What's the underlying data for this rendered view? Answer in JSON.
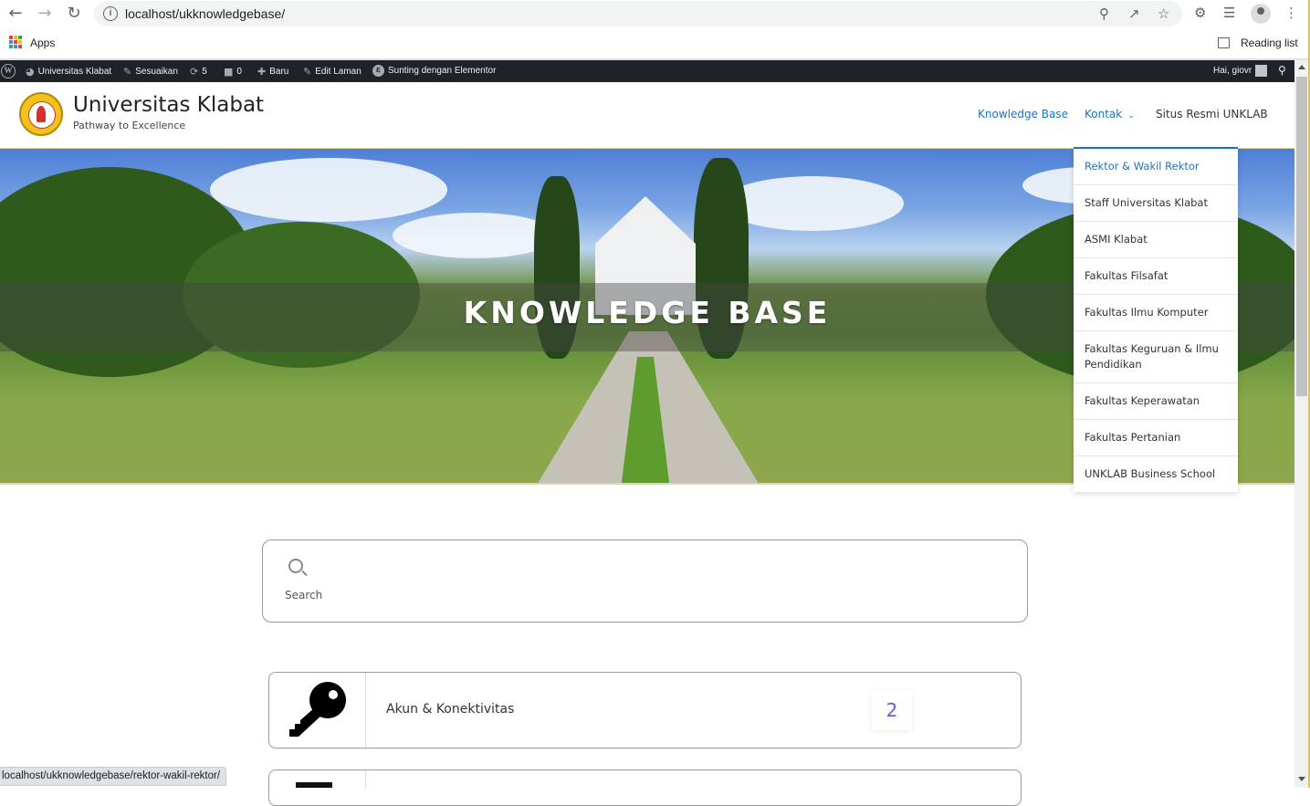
{
  "browser": {
    "url": "localhost/ukknowledgebase/",
    "bookmarks": {
      "apps_label": "Apps",
      "reading_list_label": "Reading list"
    },
    "status_url": "localhost/ukknowledgebase/rektor-wakil-rektor/"
  },
  "admin_bar": {
    "site_name": "Universitas Klabat",
    "customize": "Sesuaikan",
    "updates_count": "5",
    "comments_count": "0",
    "new": "Baru",
    "edit_page": "Edit Laman",
    "elementor": "Sunting dengan Elementor",
    "greeting": "Hai, giovr"
  },
  "site": {
    "title": "Universitas Klabat",
    "tagline": "Pathway to Excellence"
  },
  "menu": {
    "items": [
      {
        "label": "Knowledge Base"
      },
      {
        "label": "Kontak"
      },
      {
        "label": "Situs Resmi UNKLAB"
      }
    ],
    "dropdown": [
      "Rektor & Wakil Rektor",
      "Staff Universitas Klabat",
      "ASMI Klabat",
      "Fakultas Filsafat",
      "Fakultas Ilmu Komputer",
      "Fakultas Keguruan & Ilmu Pendidikan",
      "Fakultas Keperawatan",
      "Fakultas Pertanian",
      "UNKLAB Business School"
    ]
  },
  "hero": {
    "title": "KNOWLEDGE BASE"
  },
  "search": {
    "label": "Search"
  },
  "categories": [
    {
      "title": "Akun & Konektivitas",
      "count": "2",
      "icon": "key-icon"
    }
  ],
  "colors": {
    "link": "#1e73be",
    "admin_bar": "#1d2327",
    "count": "#6b5bd6"
  }
}
